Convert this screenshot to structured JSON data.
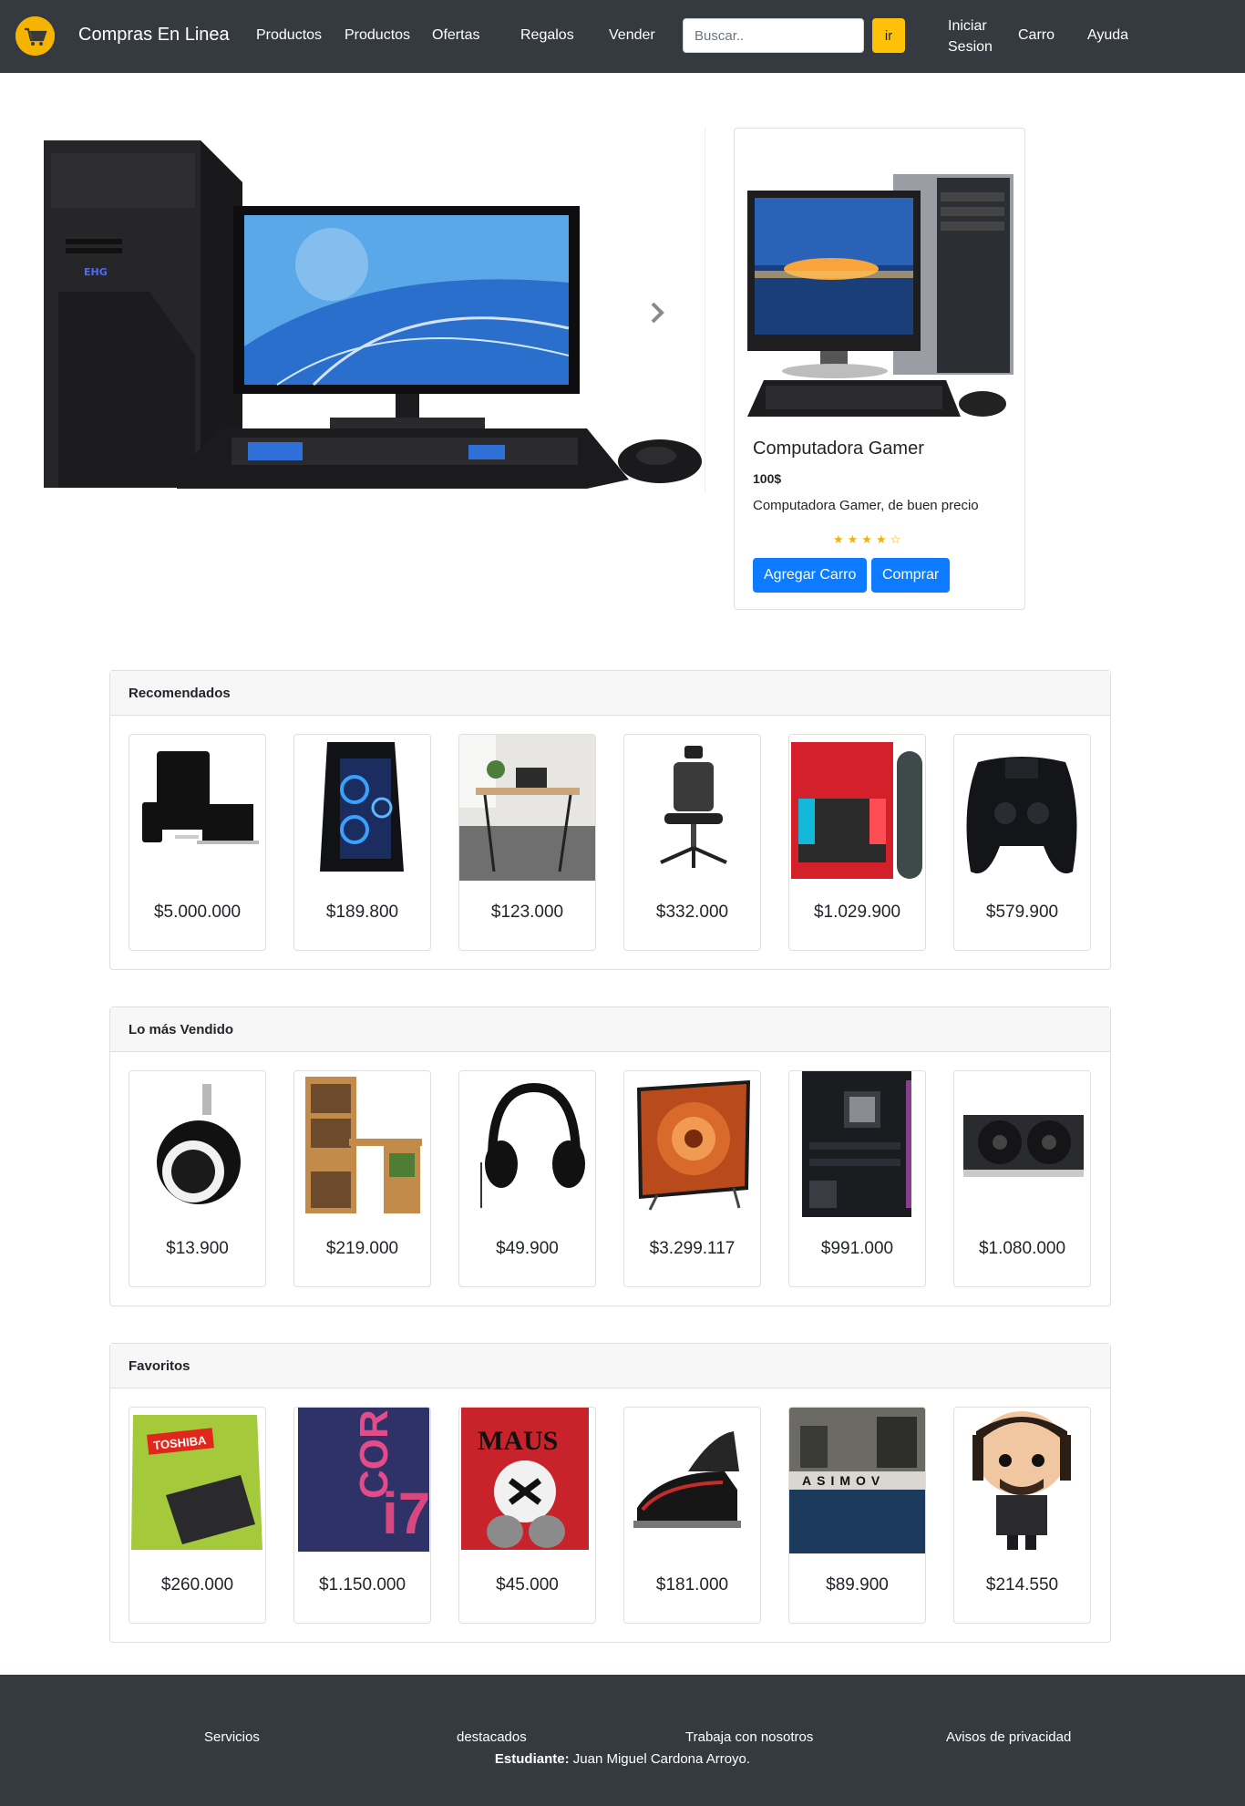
{
  "navbar": {
    "brand": "Compras En Linea",
    "links": [
      "Productos",
      "Productos",
      "Ofertas",
      "Regalos",
      "Vender"
    ],
    "search_placeholder": "Buscar..",
    "search_button": "ir",
    "login_line1": "Iniciar",
    "login_line2": "Sesion",
    "cart": "Carro",
    "help": "Ayuda"
  },
  "featured": {
    "title": "Computadora Gamer",
    "price": "100$",
    "description": "Computadora Gamer, de buen precio",
    "rating": 4,
    "rating_max": 5,
    "stars": "★★★★☆",
    "add_to_cart": "Agregar Carro",
    "buy": "Comprar"
  },
  "sections": [
    {
      "title": "Recomendados",
      "items": [
        {
          "price": "$5.000.000",
          "icon": "apple-devices"
        },
        {
          "price": "$189.800",
          "icon": "gaming-pc-tower"
        },
        {
          "price": "$123.000",
          "icon": "desk"
        },
        {
          "price": "$332.000",
          "icon": "office-chair"
        },
        {
          "price": "$1.029.900",
          "icon": "nintendo-switch"
        },
        {
          "price": "$579.900",
          "icon": "game-controller"
        }
      ]
    },
    {
      "title": "Lo más Vendido",
      "items": [
        {
          "price": "$13.900",
          "icon": "chair-wheel"
        },
        {
          "price": "$219.000",
          "icon": "bookshelf-desk"
        },
        {
          "price": "$49.900",
          "icon": "headphones"
        },
        {
          "price": "$3.299.117",
          "icon": "television"
        },
        {
          "price": "$991.000",
          "icon": "motherboard"
        },
        {
          "price": "$1.080.000",
          "icon": "graphics-card"
        }
      ]
    },
    {
      "title": "Favoritos",
      "items": [
        {
          "price": "$260.000",
          "icon": "external-hard-drive"
        },
        {
          "price": "$1.150.000",
          "icon": "processor-box"
        },
        {
          "price": "$45.000",
          "icon": "book-maus"
        },
        {
          "price": "$181.000",
          "icon": "iron"
        },
        {
          "price": "$89.900",
          "icon": "book-asimov"
        },
        {
          "price": "$214.550",
          "icon": "funko-figure"
        }
      ]
    }
  ],
  "product_art": {
    "toshiba": "TOSHIBA",
    "core": "CORE",
    "i7": "i7",
    "maus": "MAUS",
    "asimov": "ASIMOV"
  },
  "footer": {
    "links": [
      "Servicios",
      "destacados",
      "Trabaja con nosotros",
      "Avisos de privacidad"
    ],
    "credit_label": "Estudiante:",
    "credit_name": "Juan Miguel Cardona Arroyo."
  },
  "colors": {
    "navbar": "#343a40",
    "accent": "#ffc107",
    "primary": "#0d7bff",
    "star": "#f5b400"
  }
}
